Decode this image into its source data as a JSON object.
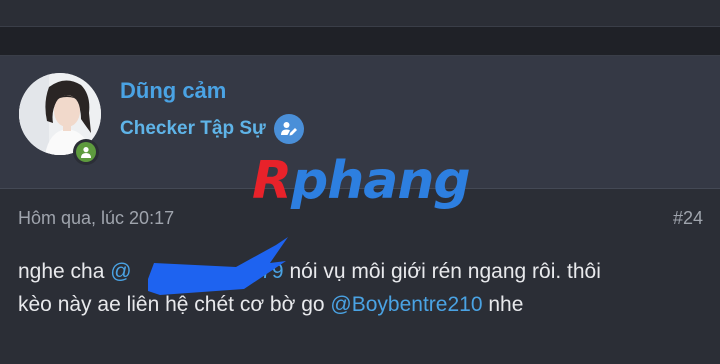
{
  "post": {
    "username": "Dũng cảm",
    "user_title": "Checker Tập Sự",
    "timestamp": "Hôm qua, lúc 20:17",
    "post_number": "#24",
    "body": {
      "line1_text1": "nghe cha ",
      "mention1_start": "@",
      "mention1_end": "279",
      "line1_text2": " nói vụ môi giới rén ngang rôi. thôi",
      "line2_text1": "kèo này ae liên hệ chét cơ bờ go ",
      "mention2": "@Boybentre210",
      "line2_text2": " nhe"
    }
  },
  "watermark": {
    "first_letter": "R",
    "rest": "phang"
  },
  "icons": {
    "online": "user-icon",
    "verified": "user-edit-icon"
  },
  "colors": {
    "background": "#1f2127",
    "card": "#2b2e36",
    "header": "#353945",
    "link": "#4aa3e4",
    "online": "#5e9b3e",
    "redaction": "#1e63f0"
  }
}
